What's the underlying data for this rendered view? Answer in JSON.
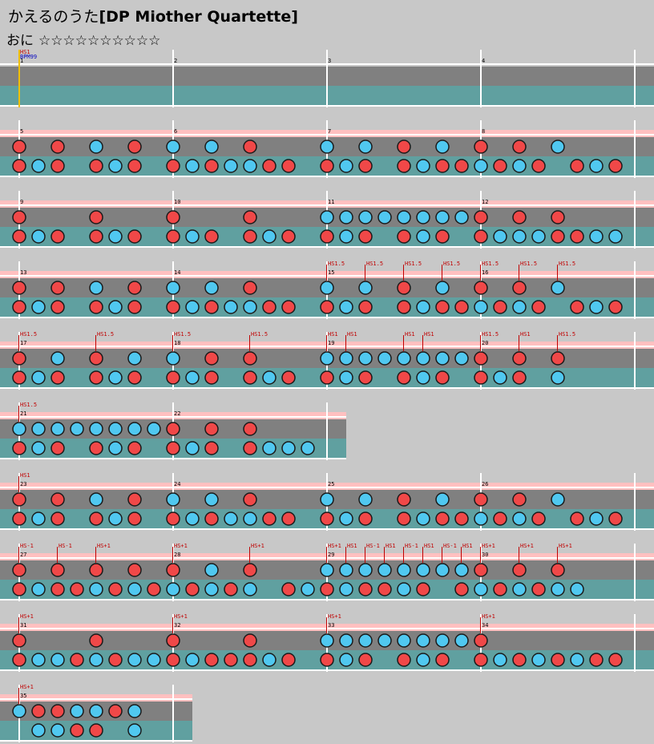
{
  "header": {
    "title_jp": "かえるのうた",
    "title_en": "[DP Miother Quartette]",
    "course_label": "おに",
    "stars": "☆☆☆☆☆☆☆☆☆☆"
  },
  "colors": {
    "background": "#c8c8c8",
    "sv_band": "#ffc0c0",
    "lane_top": "#808080",
    "lane_bottom": "#60a0a0",
    "barline": "#ffffff",
    "don": "#f04848",
    "ka": "#50c8f0",
    "event_text": "#c00000",
    "bpm_text": "#0000c0",
    "start_line": "#f0c000"
  },
  "chart_data": {
    "type": "table",
    "lanes": [
      "top",
      "bottom"
    ],
    "note_key": {
      "d": "don (red)",
      "k": "ka (blue)",
      "0": "rest"
    },
    "bpm_label": "BPM99",
    "measures_per_row": 4,
    "rows": [
      {
        "measures": [
          1,
          2,
          3,
          4
        ],
        "events": [
          {
            "label": "HS1",
            "pos": 0
          },
          {
            "label": "BPM99",
            "pos": 0,
            "kind": "bpm"
          }
        ],
        "top": "0000000000000000000000000000000000000000000000000000000000000000",
        "bottom": "0000000000000000000000000000000000000000000000000000000000000000"
      },
      {
        "measures": [
          5,
          6,
          7,
          8
        ],
        "events": [],
        "top": "d0d0k0d0k0k0d000k0k0d0k0d0d0k000",
        "bottom": "dkd0dkd0dkdkkdd0dkd0dkddkdkd0dkd"
      },
      {
        "measures": [
          9,
          10,
          11,
          12
        ],
        "events": [],
        "top": "d000d000d000d000kkkkkkkkd0d0d000",
        "bottom": "dkd0dkd0dkd0dkd0dkd0dkd0dkkkddkk"
      },
      {
        "measures": [
          13,
          14,
          15,
          16
        ],
        "events": [
          {
            "label": "HS1.5",
            "pos": 16
          },
          {
            "label": "HS1.5",
            "pos": 18
          },
          {
            "label": "HS1.5",
            "pos": 20
          },
          {
            "label": "HS1.5",
            "pos": 22
          },
          {
            "label": "HS1.5",
            "pos": 24
          },
          {
            "label": "HS1.5",
            "pos": 26
          },
          {
            "label": "HS1.5",
            "pos": 28
          }
        ],
        "top": "d0d0k0d0k0k0d000k0k0d0k0d0d0k000",
        "bottom": "dkd0dkd0dkdkkdd0dkd0dkddkdkd0dkd"
      },
      {
        "measures": [
          17,
          18,
          19,
          20
        ],
        "events": [
          {
            "label": "HS1.5",
            "pos": 0
          },
          {
            "label": "HS1.5",
            "pos": 4
          },
          {
            "label": "HS1.5",
            "pos": 8
          },
          {
            "label": "HS1.5",
            "pos": 12
          },
          {
            "label": "HS1",
            "pos": 16
          },
          {
            "label": "HS1",
            "pos": 17
          },
          {
            "label": "HS1",
            "pos": 20
          },
          {
            "label": "HS1",
            "pos": 21
          },
          {
            "label": "HS1.5",
            "pos": 24
          },
          {
            "label": "HS1",
            "pos": 26
          },
          {
            "label": "HS1.5",
            "pos": 28
          }
        ],
        "top": "d0k0d0k0k0d0d000kkkkkkkkd0d0d000",
        "bottom": "dkd0dkd0dkd0dkd0dkd0dkd0dkd0k000"
      },
      {
        "measures": [
          21,
          22
        ],
        "events": [
          {
            "label": "HS1.5",
            "pos": 0
          }
        ],
        "top": "kkkkkkkkd0d0d000",
        "bottom": "dkd0dkd0dkd0dkkk"
      },
      {
        "measures": [
          23,
          24,
          25,
          26
        ],
        "events": [
          {
            "label": "HS1",
            "pos": 0
          }
        ],
        "top": "d0d0k0d0k0k0d000k0k0d0k0d0d0k000",
        "bottom": "dkd0dkd0dkdkkdd0dkd0dkddkdkd0dkd"
      },
      {
        "measures": [
          27,
          28,
          29,
          30
        ],
        "events": [
          {
            "label": "HS-1",
            "pos": 0
          },
          {
            "label": "HS-1",
            "pos": 2
          },
          {
            "label": "HS+1",
            "pos": 4
          },
          {
            "label": "HS+1",
            "pos": 8
          },
          {
            "label": "HS+1",
            "pos": 12
          },
          {
            "label": "HS+1",
            "pos": 16
          },
          {
            "label": "HS1",
            "pos": 17
          },
          {
            "label": "HS-1",
            "pos": 18
          },
          {
            "label": "HS1",
            "pos": 19
          },
          {
            "label": "HS-1",
            "pos": 20
          },
          {
            "label": "HS1",
            "pos": 21
          },
          {
            "label": "HS-1",
            "pos": 22
          },
          {
            "label": "HS1",
            "pos": 23
          },
          {
            "label": "HS+1",
            "pos": 24
          },
          {
            "label": "HS+1",
            "pos": 26
          },
          {
            "label": "HS+1",
            "pos": 28
          }
        ],
        "top": "d0d0d0d0d0k0d000kkkkkkkkd0d0d000",
        "bottom": "dkddkdkdkdkdk0dkdkddkd0dkdkdkk00"
      },
      {
        "measures": [
          31,
          32,
          33,
          34
        ],
        "events": [
          {
            "label": "HS+1",
            "pos": 0
          },
          {
            "label": "HS+1",
            "pos": 8
          },
          {
            "label": "HS+1",
            "pos": 16
          },
          {
            "label": "HS+1",
            "pos": 24
          }
        ],
        "top": "d000d000d000d000kkkkkkkkd0000000",
        "bottom": "dkkdkdkkdkdddkd0dkd0dkd0dkdkdkdd"
      },
      {
        "measures": [
          35
        ],
        "events": [
          {
            "label": "HS+1",
            "pos": 0
          }
        ],
        "top": "kddkkdk0",
        "bottom": "0kkdd0k0"
      }
    ]
  }
}
